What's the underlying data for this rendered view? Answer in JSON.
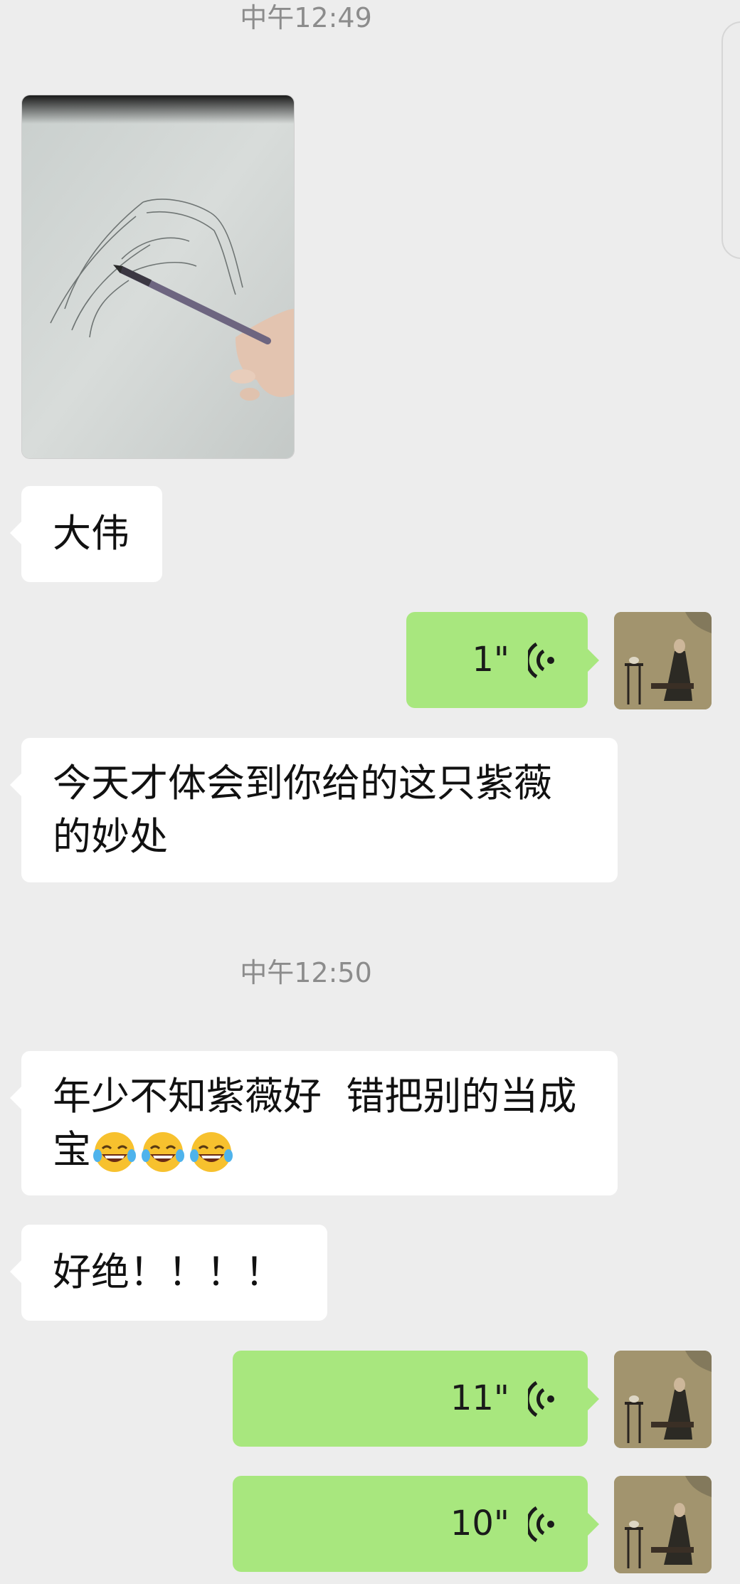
{
  "timestamps": [
    "中午12:49",
    "中午12:50"
  ],
  "messages": {
    "photo": {
      "description_icon": "sketch-photo"
    },
    "m1": {
      "text": "大伟"
    },
    "v1": {
      "duration": "1\""
    },
    "m2": {
      "line1": "今天才体会到你给的这只紫薇",
      "line2": "的妙处"
    },
    "m3": {
      "line1": "年少不知紫薇好  错把别的当成",
      "line2": "宝",
      "emojis": [
        "😂",
        "😂",
        "😂"
      ]
    },
    "m4": {
      "text": "好绝！！！！"
    },
    "v2": {
      "duration": "11\""
    },
    "v3": {
      "duration": "10\""
    }
  },
  "colors": {
    "background": "#ededed",
    "incoming_bubble": "#ffffff",
    "outgoing_bubble": "#a8e77e",
    "timestamp": "#8c8c8c"
  }
}
